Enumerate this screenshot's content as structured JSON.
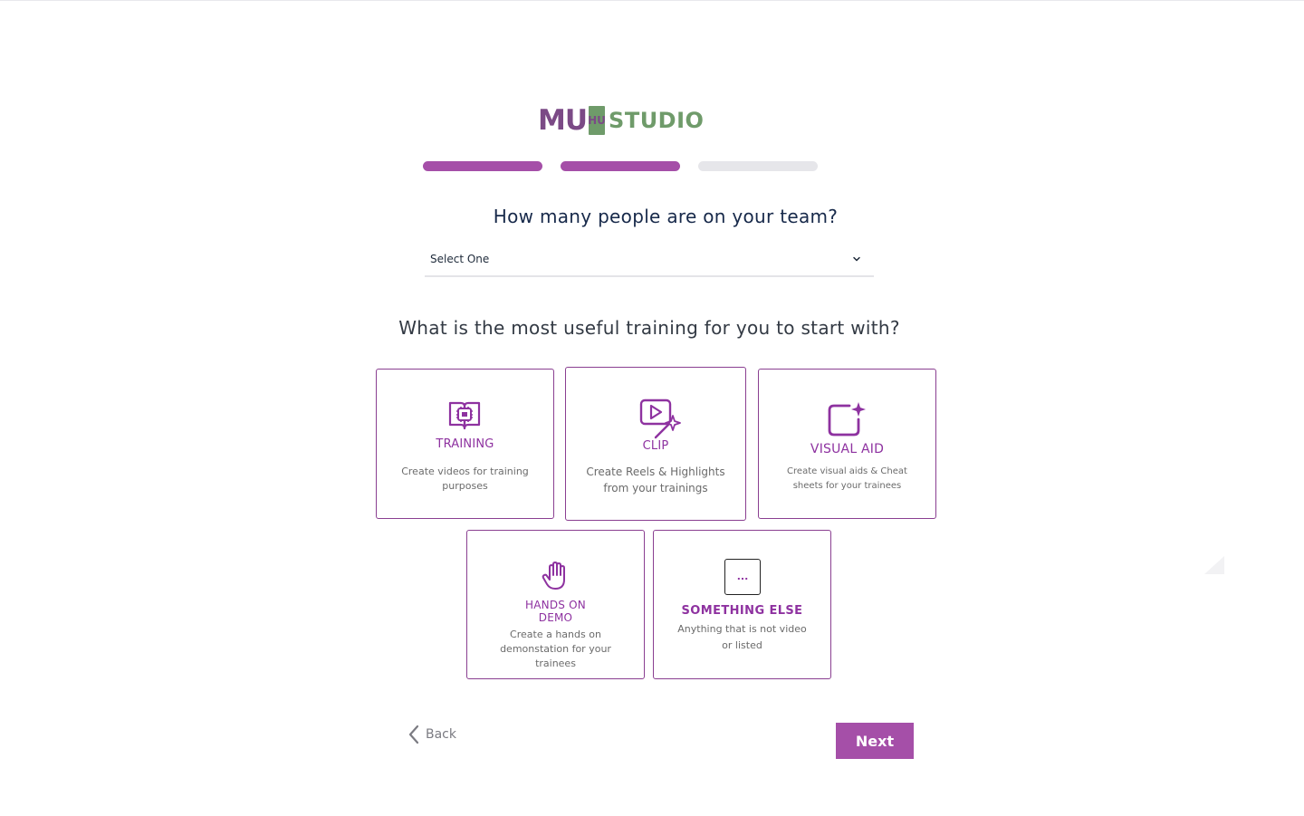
{
  "brand": {
    "logo_text_main": "MU",
    "logo_text_badge": "HU",
    "logo_text_studio": "STUDIO",
    "colors": {
      "purple": "#7b4a86",
      "green": "#6f9b6a"
    }
  },
  "progress": {
    "current_step": 2,
    "total_steps": 3,
    "colors": {
      "active": "#a54fa8",
      "inactive": "#e6e6ea"
    }
  },
  "team_question": {
    "label": "How many people are on your team?",
    "select_value": "Select One",
    "icon": "chevron-down-icon"
  },
  "training_question": {
    "label": "What is the most useful training for you to start with?"
  },
  "options": [
    {
      "id": "training",
      "title": "TRAINING",
      "description": "Create videos for training purposes",
      "icon": "book-chip-icon"
    },
    {
      "id": "clip",
      "title": "CLIP",
      "description": "Create Reels & Highlights from your trainings",
      "icon": "video-sparkle-icon"
    },
    {
      "id": "visual_aid",
      "title": "VISUAL AID",
      "description": "Create visual aids & Cheat sheets for your trainees",
      "icon": "square-sparkle-icon"
    },
    {
      "id": "hands_on_demo",
      "title_line1": "HANDS ON",
      "title_line2": "DEMO",
      "description": "Create a hands on demonstation for your trainees",
      "icon": "hand-icon"
    },
    {
      "id": "something_else",
      "title": "SOMETHING ELSE",
      "description": "Anything that is not video or listed",
      "icon": "ellipsis-box-icon",
      "icon_text": "..."
    }
  ],
  "nav": {
    "back_label": "Back",
    "next_label": "Next",
    "accent": "#a54fa8"
  }
}
